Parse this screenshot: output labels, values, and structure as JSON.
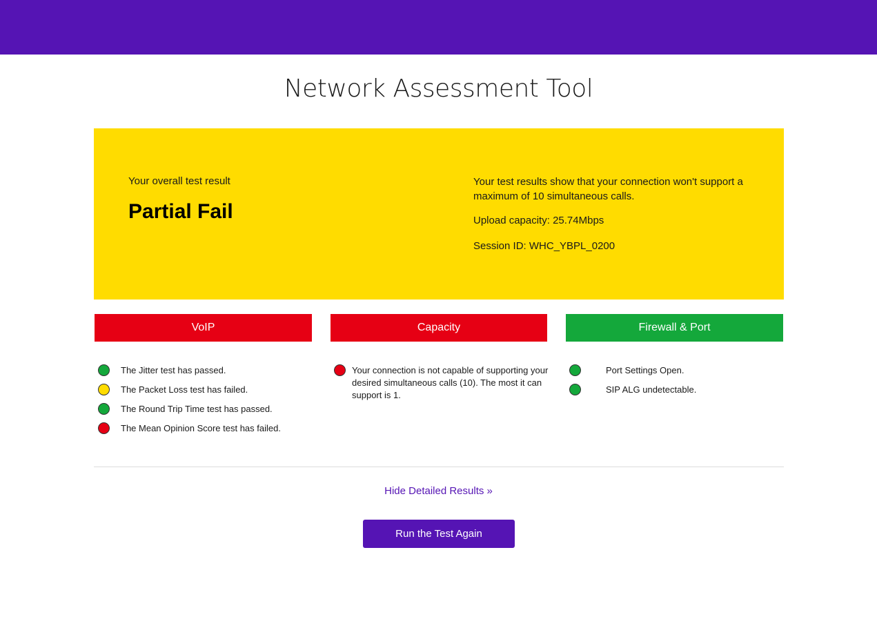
{
  "page": {
    "title": "Network Assessment Tool"
  },
  "colors": {
    "brand": "#5514b4",
    "panel": "#ffdc00",
    "pass": "#14a83b",
    "warn": "#ffdc00",
    "fail": "#e60014"
  },
  "result": {
    "overall_label": "Your overall test result",
    "overall_value": "Partial Fail",
    "summary": "Your test results show that your connection won't support a maximum of 10 simultaneous calls.",
    "upload": "Upload capacity: 25.74Mbps",
    "session": "Session ID: WHC_YBPL_0200"
  },
  "categories": [
    {
      "label": "VoIP",
      "status": "fail",
      "items": [
        {
          "text": "The Jitter test has passed.",
          "status": "pass"
        },
        {
          "text": "The Packet Loss test has failed.",
          "status": "warn"
        },
        {
          "text": "The Round Trip Time test has passed.",
          "status": "pass"
        },
        {
          "text": "The Mean Opinion Score test has failed.",
          "status": "fail"
        }
      ]
    },
    {
      "label": "Capacity",
      "status": "fail",
      "items": [
        {
          "text": "Your connection is not capable of supporting your desired simultaneous calls (10). The most it can support is 1.",
          "status": "fail"
        }
      ]
    },
    {
      "label": "Firewall & Port",
      "status": "pass",
      "items": [
        {
          "text": "Port Settings Open.",
          "status": "pass"
        },
        {
          "text": "SIP ALG undetectable.",
          "status": "pass"
        }
      ]
    }
  ],
  "actions": {
    "hide_details": "Hide Detailed Results »",
    "run_again": "Run the Test Again"
  }
}
